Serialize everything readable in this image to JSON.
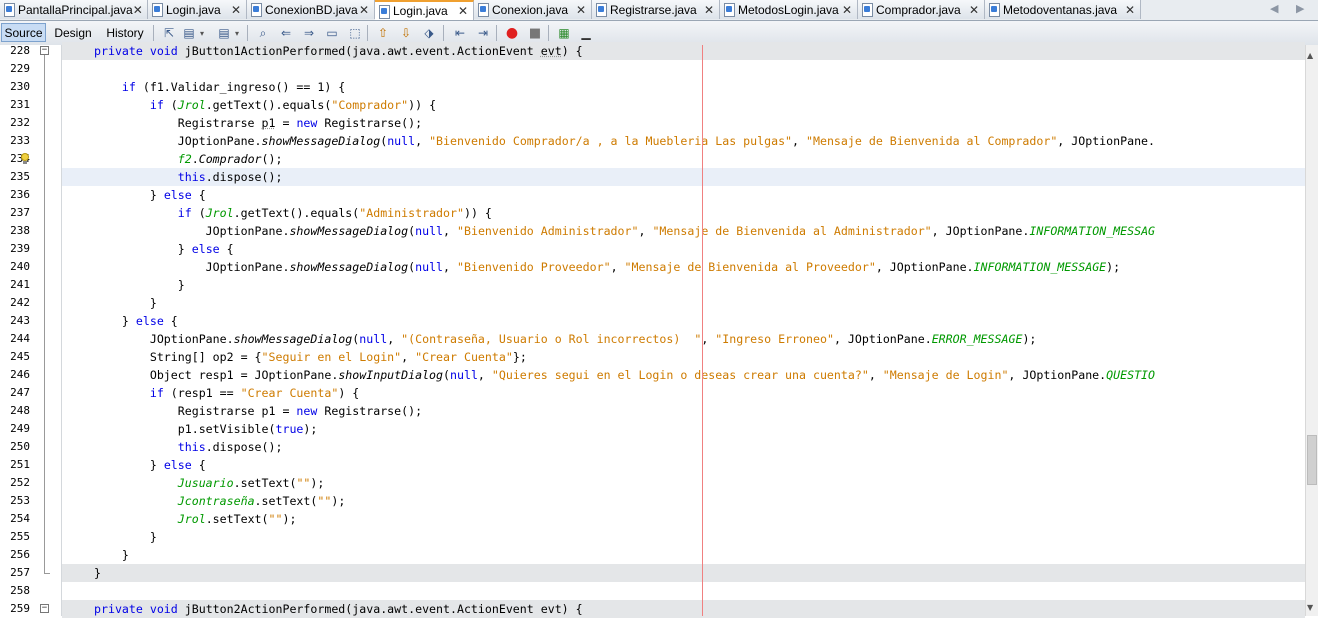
{
  "tabs": [
    {
      "label": "PantallaPrincipal.java",
      "active": false
    },
    {
      "label": "Login.java",
      "active": false
    },
    {
      "label": "ConexionBD.java",
      "active": false
    },
    {
      "label": "Login.java",
      "active": true
    },
    {
      "label": "Conexion.java",
      "active": false
    },
    {
      "label": "Registrarse.java",
      "active": false
    },
    {
      "label": "MetodosLogin.java",
      "active": false
    },
    {
      "label": "Comprador.java",
      "active": false
    },
    {
      "label": "Metodoventanas.java",
      "active": false
    }
  ],
  "tab_close_glyph": "✕",
  "nav_left_glyph": "◀",
  "nav_right_glyph": "▶",
  "toolbar": {
    "source_label": "Source",
    "design_label": "Design",
    "history_label": "History",
    "icons": [
      "last-edit-icon",
      "back-icon",
      "forward-icon",
      "find-icon",
      "find-previous-icon",
      "find-next-icon",
      "find-selection-icon",
      "toggle-highlight-icon",
      "shift-left-icon",
      "shift-right-icon",
      "toggle-bookmark-icon",
      "prev-bookmark-icon",
      "next-bookmark-icon",
      "comment-icon",
      "uncomment-icon",
      "start-macro-icon",
      "stop-macro-icon",
      "diff-icon",
      "format-icon"
    ]
  },
  "colors": {
    "keyword": "#0000e6",
    "string": "#ce7b00",
    "field": "#009900",
    "current_line": "#e9eff8",
    "margin_line": "#f08080"
  },
  "editor": {
    "current_line": 235,
    "lines": [
      {
        "n": "228",
        "segs": [
          [
            "kw",
            "private void "
          ],
          [
            "",
            "jButton1ActionPerformed(java.awt.event.ActionEvent "
          ],
          [
            "und",
            "evt"
          ],
          [
            "",
            ") {"
          ]
        ]
      },
      {
        "n": "229",
        "segs": []
      },
      {
        "n": "230",
        "segs": [
          [
            "",
            "    "
          ],
          [
            "kw",
            "if"
          ],
          [
            "",
            " (f1.Validar_ingreso() == 1) {"
          ]
        ]
      },
      {
        "n": "231",
        "segs": [
          [
            "",
            "        "
          ],
          [
            "kw",
            "if"
          ],
          [
            "",
            " ("
          ],
          [
            "fld",
            "Jrol"
          ],
          [
            "",
            ".getText().equals("
          ],
          [
            "str",
            "\"Comprador\""
          ],
          [
            "",
            ")) {"
          ]
        ]
      },
      {
        "n": "232",
        "segs": [
          [
            "",
            "            Registrarse "
          ],
          [
            "und",
            "p1"
          ],
          [
            "",
            " = "
          ],
          [
            "kw",
            "new"
          ],
          [
            "",
            " Registrarse();"
          ]
        ]
      },
      {
        "n": "233",
        "segs": [
          [
            "",
            "            JOptionPane."
          ],
          [
            "stat",
            "showMessageDialog"
          ],
          [
            "",
            "("
          ],
          [
            "kw",
            "null"
          ],
          [
            "",
            ", "
          ],
          [
            "str",
            "\"Bienvenido Comprador/a , a la Muebleria Las pulgas\""
          ],
          [
            "",
            ", "
          ],
          [
            "str",
            "\"Mensaje de Bienvenida al Comprador\""
          ],
          [
            "",
            ", JOptionPane."
          ]
        ]
      },
      {
        "n": "234",
        "segs": [
          [
            "",
            "            "
          ],
          [
            "fld",
            "f2"
          ],
          [
            "",
            "."
          ],
          [
            "stat",
            "Comprador"
          ],
          [
            "",
            "();"
          ]
        ]
      },
      {
        "n": "235",
        "segs": [
          [
            "",
            "            "
          ],
          [
            "kw",
            "this"
          ],
          [
            "",
            ".dispose();"
          ]
        ]
      },
      {
        "n": "236",
        "segs": [
          [
            "",
            "        } "
          ],
          [
            "kw",
            "else"
          ],
          [
            "",
            " {"
          ]
        ]
      },
      {
        "n": "237",
        "segs": [
          [
            "",
            "            "
          ],
          [
            "kw",
            "if"
          ],
          [
            "",
            " ("
          ],
          [
            "fld",
            "Jrol"
          ],
          [
            "",
            ".getText().equals("
          ],
          [
            "str",
            "\"Administrador\""
          ],
          [
            "",
            ")) {"
          ]
        ]
      },
      {
        "n": "238",
        "segs": [
          [
            "",
            "                JOptionPane."
          ],
          [
            "stat",
            "showMessageDialog"
          ],
          [
            "",
            "("
          ],
          [
            "kw",
            "null"
          ],
          [
            "",
            ", "
          ],
          [
            "str",
            "\"Bienvenido Administrador\""
          ],
          [
            "",
            ", "
          ],
          [
            "str",
            "\"Mensaje de Bienvenida al Administrador\""
          ],
          [
            "",
            ", JOptionPane."
          ],
          [
            "stfld",
            "INFORMATION_MESSAG"
          ]
        ]
      },
      {
        "n": "239",
        "segs": [
          [
            "",
            "            } "
          ],
          [
            "kw",
            "else"
          ],
          [
            "",
            " {"
          ]
        ]
      },
      {
        "n": "240",
        "segs": [
          [
            "",
            "                JOptionPane."
          ],
          [
            "stat",
            "showMessageDialog"
          ],
          [
            "",
            "("
          ],
          [
            "kw",
            "null"
          ],
          [
            "",
            ", "
          ],
          [
            "str",
            "\"Bienvenido Proveedor\""
          ],
          [
            "",
            ", "
          ],
          [
            "str",
            "\"Mensaje de Bienvenida al Proveedor\""
          ],
          [
            "",
            ", JOptionPane."
          ],
          [
            "stfld",
            "INFORMATION_MESSAGE"
          ],
          [
            "",
            ");"
          ]
        ]
      },
      {
        "n": "241",
        "segs": [
          [
            "",
            "            }"
          ]
        ]
      },
      {
        "n": "242",
        "segs": [
          [
            "",
            "        }"
          ]
        ]
      },
      {
        "n": "243",
        "segs": [
          [
            "",
            "    } "
          ],
          [
            "kw",
            "else"
          ],
          [
            "",
            " {"
          ]
        ]
      },
      {
        "n": "244",
        "segs": [
          [
            "",
            "        JOptionPane."
          ],
          [
            "stat",
            "showMessageDialog"
          ],
          [
            "",
            "("
          ],
          [
            "kw",
            "null"
          ],
          [
            "",
            ", "
          ],
          [
            "str",
            "\"(Contraseña, Usuario o Rol incorrectos)  \""
          ],
          [
            "",
            ", "
          ],
          [
            "str",
            "\"Ingreso Erroneo\""
          ],
          [
            "",
            ", JOptionPane."
          ],
          [
            "stfld",
            "ERROR_MESSAGE"
          ],
          [
            "",
            ");"
          ]
        ]
      },
      {
        "n": "245",
        "segs": [
          [
            "",
            "        String[] op2 = {"
          ],
          [
            "str",
            "\"Seguir en el Login\""
          ],
          [
            "",
            ", "
          ],
          [
            "str",
            "\"Crear Cuenta\""
          ],
          [
            "",
            "};"
          ]
        ]
      },
      {
        "n": "246",
        "segs": [
          [
            "",
            "        Object resp1 = JOptionPane."
          ],
          [
            "stat",
            "showInputDialog"
          ],
          [
            "",
            "("
          ],
          [
            "kw",
            "null"
          ],
          [
            "",
            ", "
          ],
          [
            "str",
            "\"Quieres segui en el Login o deseas crear una cuenta?\""
          ],
          [
            "",
            ", "
          ],
          [
            "str",
            "\"Mensaje de Login\""
          ],
          [
            "",
            ", JOptionPane."
          ],
          [
            "stfld",
            "QUESTIO"
          ]
        ]
      },
      {
        "n": "247",
        "segs": [
          [
            "",
            "        "
          ],
          [
            "kw",
            "if"
          ],
          [
            "",
            " (resp1 == "
          ],
          [
            "str",
            "\"Crear Cuenta\""
          ],
          [
            "",
            ") {"
          ]
        ]
      },
      {
        "n": "248",
        "segs": [
          [
            "",
            "            Registrarse p1 = "
          ],
          [
            "kw",
            "new"
          ],
          [
            "",
            " Registrarse();"
          ]
        ]
      },
      {
        "n": "249",
        "segs": [
          [
            "",
            "            p1.setVisible("
          ],
          [
            "kw",
            "true"
          ],
          [
            "",
            ");"
          ]
        ]
      },
      {
        "n": "250",
        "segs": [
          [
            "",
            "            "
          ],
          [
            "kw",
            "this"
          ],
          [
            "",
            ".dispose();"
          ]
        ]
      },
      {
        "n": "251",
        "segs": [
          [
            "",
            "        } "
          ],
          [
            "kw",
            "else"
          ],
          [
            "",
            " {"
          ]
        ]
      },
      {
        "n": "252",
        "segs": [
          [
            "",
            "            "
          ],
          [
            "fld",
            "Jusuario"
          ],
          [
            "",
            ".setText("
          ],
          [
            "str",
            "\"\""
          ],
          [
            "",
            ");"
          ]
        ]
      },
      {
        "n": "253",
        "segs": [
          [
            "",
            "            "
          ],
          [
            "fld",
            "Jcontraseña"
          ],
          [
            "",
            ".setText("
          ],
          [
            "str",
            "\"\""
          ],
          [
            "",
            ");"
          ]
        ]
      },
      {
        "n": "254",
        "segs": [
          [
            "",
            "            "
          ],
          [
            "fld",
            "Jrol"
          ],
          [
            "",
            ".setText("
          ],
          [
            "str",
            "\"\""
          ],
          [
            "",
            ");"
          ]
        ]
      },
      {
        "n": "255",
        "segs": [
          [
            "",
            "        }"
          ]
        ]
      },
      {
        "n": "256",
        "segs": [
          [
            "",
            "    }"
          ]
        ]
      },
      {
        "n": "257",
        "segs": [
          [
            "",
            "}"
          ]
        ]
      },
      {
        "n": "258",
        "segs": []
      },
      {
        "n": "259",
        "segs": [
          [
            "kw",
            "private void "
          ],
          [
            "",
            "jButton2ActionPerformed(java.awt.event.ActionEvent evt) {"
          ]
        ]
      }
    ]
  }
}
